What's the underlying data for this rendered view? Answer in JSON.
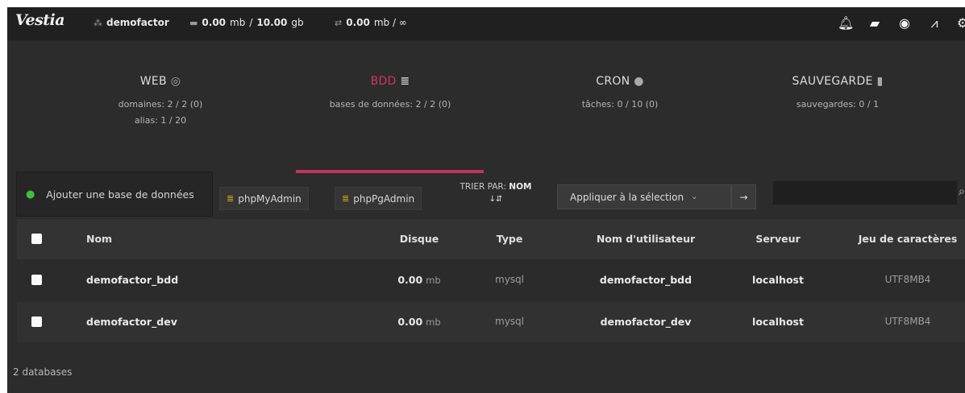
{
  "topbar": {
    "logo": "Vestia",
    "user": "demofactor",
    "disk_used": "0.00",
    "disk_used_unit": "mb",
    "disk_total": "10.00",
    "disk_total_unit": "gb",
    "bw_used": "0.00",
    "bw_rest": "mb / ∞",
    "icons": [
      "bell-icon",
      "folder-icon",
      "user-circle-icon",
      "chart-icon",
      "gear-icon"
    ]
  },
  "overview": [
    {
      "title": "WEB",
      "icon": "globe-icon",
      "line1": "domaines: 2 / 2 (0)",
      "line2": "alias: 1 / 20"
    },
    {
      "title": "BDD",
      "icon": "database-icon",
      "line1": "bases de données: 2 / 2 (0)",
      "line2": ""
    },
    {
      "title": "CRON",
      "icon": "clock-icon",
      "line1": "tâches: 0 / 10 (0)",
      "line2": ""
    },
    {
      "title": "SAUVEGARDE",
      "icon": "file-icon",
      "line1": "sauvegardes: 0 / 1",
      "line2": ""
    }
  ],
  "toolbar": {
    "add_label": "Ajouter une base de données",
    "phpmyadmin": "phpMyAdmin",
    "phppgadmin": "phpPgAdmin",
    "sort_label": "TRIER PAR:",
    "sort_value": "NOM",
    "sort_icon": "↓⇵",
    "apply_label": "Appliquer à la sélection",
    "search_placeholder": ""
  },
  "table": {
    "headers": {
      "name": "Nom",
      "disk": "Disque",
      "type": "Type",
      "user": "Nom d'utilisateur",
      "server": "Serveur",
      "charset": "Jeu de caractères"
    },
    "rows": [
      {
        "name": "demofactor_bdd",
        "disk": "0.00",
        "disk_unit": "mb",
        "type": "mysql",
        "user": "demofactor_bdd",
        "server": "localhost",
        "charset": "UTF8MB4"
      },
      {
        "name": "demofactor_dev",
        "disk": "0.00",
        "disk_unit": "mb",
        "type": "mysql",
        "user": "demofactor_dev",
        "server": "localhost",
        "charset": "UTF8MB4"
      }
    ]
  },
  "footer": {
    "count": "2 databases"
  },
  "colors": {
    "accent": "#c5325c",
    "add_icon": "#3fbf3f",
    "db_icon": "#e8b316"
  }
}
